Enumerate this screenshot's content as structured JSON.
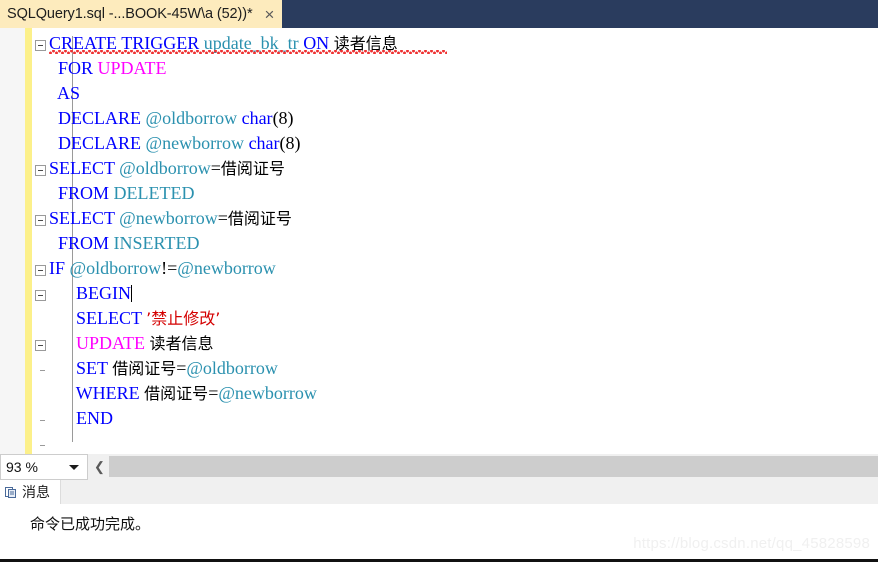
{
  "window": {
    "tab": {
      "title": "SQLQuery1.sql -...BOOK-45W\\a (52))*",
      "close_label": "×",
      "bg_color": "#fdebbd",
      "strip_color": "#2a3c5e"
    }
  },
  "editor": {
    "zoom_level": "93 %",
    "change_bar_color": "#fcf08a",
    "colors": {
      "keyword": "#0000ff",
      "keyword_alt": "#ff00ff",
      "identifier": "#2b91af",
      "string": "#d40000",
      "plain": "#000000",
      "error_squiggle": "#dd3333"
    },
    "lines": [
      {
        "indent": 0,
        "fold": "minus",
        "tokens": [
          {
            "t": "CREATE",
            "c": "kw"
          },
          {
            "t": " ",
            "c": "plain"
          },
          {
            "t": "TRIGGER",
            "c": "kw"
          },
          {
            "t": " ",
            "c": "plain"
          },
          {
            "t": "update_bk_tr",
            "c": "ident"
          },
          {
            "t": " ",
            "c": "plain"
          },
          {
            "t": "ON",
            "c": "kw"
          },
          {
            "t": " ",
            "c": "plain"
          },
          {
            "t": "读者信息",
            "c": "cjk"
          }
        ]
      },
      {
        "indent": 1,
        "fold": "none",
        "tokens": [
          {
            "t": "FOR",
            "c": "kw"
          },
          {
            "t": " ",
            "c": "plain"
          },
          {
            "t": "UPDATE",
            "c": "kw2"
          }
        ]
      },
      {
        "indent": 1,
        "fold": "none",
        "tokens": [
          {
            "t": "AS",
            "c": "kw"
          }
        ]
      },
      {
        "indent": 1,
        "fold": "none",
        "tokens": [
          {
            "t": "DECLARE",
            "c": "kw"
          },
          {
            "t": " ",
            "c": "plain"
          },
          {
            "t": "@oldborrow",
            "c": "ident"
          },
          {
            "t": " ",
            "c": "plain"
          },
          {
            "t": "char",
            "c": "kw"
          },
          {
            "t": "(8)",
            "c": "plain"
          }
        ]
      },
      {
        "indent": 1,
        "fold": "none",
        "tokens": [
          {
            "t": "DECLARE",
            "c": "kw"
          },
          {
            "t": " ",
            "c": "plain"
          },
          {
            "t": "@newborrow",
            "c": "ident"
          },
          {
            "t": " ",
            "c": "plain"
          },
          {
            "t": "char",
            "c": "kw"
          },
          {
            "t": "(8)",
            "c": "plain"
          }
        ]
      },
      {
        "indent": 0,
        "fold": "minus",
        "tokens": [
          {
            "t": "SELECT",
            "c": "kw"
          },
          {
            "t": " ",
            "c": "plain"
          },
          {
            "t": "@oldborrow",
            "c": "ident"
          },
          {
            "t": "=",
            "c": "plain"
          },
          {
            "t": "借阅证号",
            "c": "cjk"
          }
        ]
      },
      {
        "indent": 1,
        "fold": "none",
        "tokens": [
          {
            "t": "FROM",
            "c": "kw"
          },
          {
            "t": " ",
            "c": "plain"
          },
          {
            "t": "DELETED",
            "c": "ident"
          }
        ]
      },
      {
        "indent": 0,
        "fold": "minus",
        "tokens": [
          {
            "t": "SELECT",
            "c": "kw"
          },
          {
            "t": " ",
            "c": "plain"
          },
          {
            "t": "@newborrow",
            "c": "ident"
          },
          {
            "t": "=",
            "c": "plain"
          },
          {
            "t": "借阅证号",
            "c": "cjk"
          }
        ]
      },
      {
        "indent": 1,
        "fold": "none",
        "tokens": [
          {
            "t": "FROM",
            "c": "kw"
          },
          {
            "t": " ",
            "c": "plain"
          },
          {
            "t": "INSERTED",
            "c": "ident"
          }
        ]
      },
      {
        "indent": 0,
        "fold": "minus",
        "tokens": [
          {
            "t": "IF",
            "c": "kw"
          },
          {
            "t": " ",
            "c": "plain"
          },
          {
            "t": "@oldborrow",
            "c": "ident"
          },
          {
            "t": "!=",
            "c": "plain"
          },
          {
            "t": "@newborrow",
            "c": "ident"
          }
        ]
      },
      {
        "indent": 2,
        "fold": "minus",
        "caret": true,
        "tokens": [
          {
            "t": "BEGIN",
            "c": "kw"
          }
        ]
      },
      {
        "indent": 2,
        "fold": "none",
        "tokens": [
          {
            "t": "SELECT",
            "c": "kw"
          },
          {
            "t": " ",
            "c": "plain"
          },
          {
            "t": "’禁止修改’",
            "c": "str"
          }
        ]
      },
      {
        "indent": 2,
        "fold": "minus",
        "tokens": [
          {
            "t": "UPDATE",
            "c": "kw2"
          },
          {
            "t": " ",
            "c": "plain"
          },
          {
            "t": "读者信息",
            "c": "cjk"
          }
        ]
      },
      {
        "indent": 2,
        "fold": "none",
        "tokens": [
          {
            "t": "SET",
            "c": "kw"
          },
          {
            "t": " ",
            "c": "plain"
          },
          {
            "t": "借阅证号",
            "c": "cjk"
          },
          {
            "t": "=",
            "c": "plain"
          },
          {
            "t": "@oldborrow",
            "c": "ident"
          }
        ]
      },
      {
        "indent": 2,
        "fold": "none",
        "tokens": [
          {
            "t": "WHERE",
            "c": "kw"
          },
          {
            "t": " ",
            "c": "plain"
          },
          {
            "t": "借阅证号",
            "c": "cjk"
          },
          {
            "t": "=",
            "c": "plain"
          },
          {
            "t": "@newborrow",
            "c": "ident"
          }
        ]
      },
      {
        "indent": 2,
        "fold": "none",
        "tokens": [
          {
            "t": "END",
            "c": "kw"
          }
        ]
      }
    ]
  },
  "results": {
    "tab_label": "消息",
    "tab_icon": "messages-icon",
    "message": "命令已成功完成。"
  },
  "watermark": "https://blog.csdn.net/qq_45828598"
}
